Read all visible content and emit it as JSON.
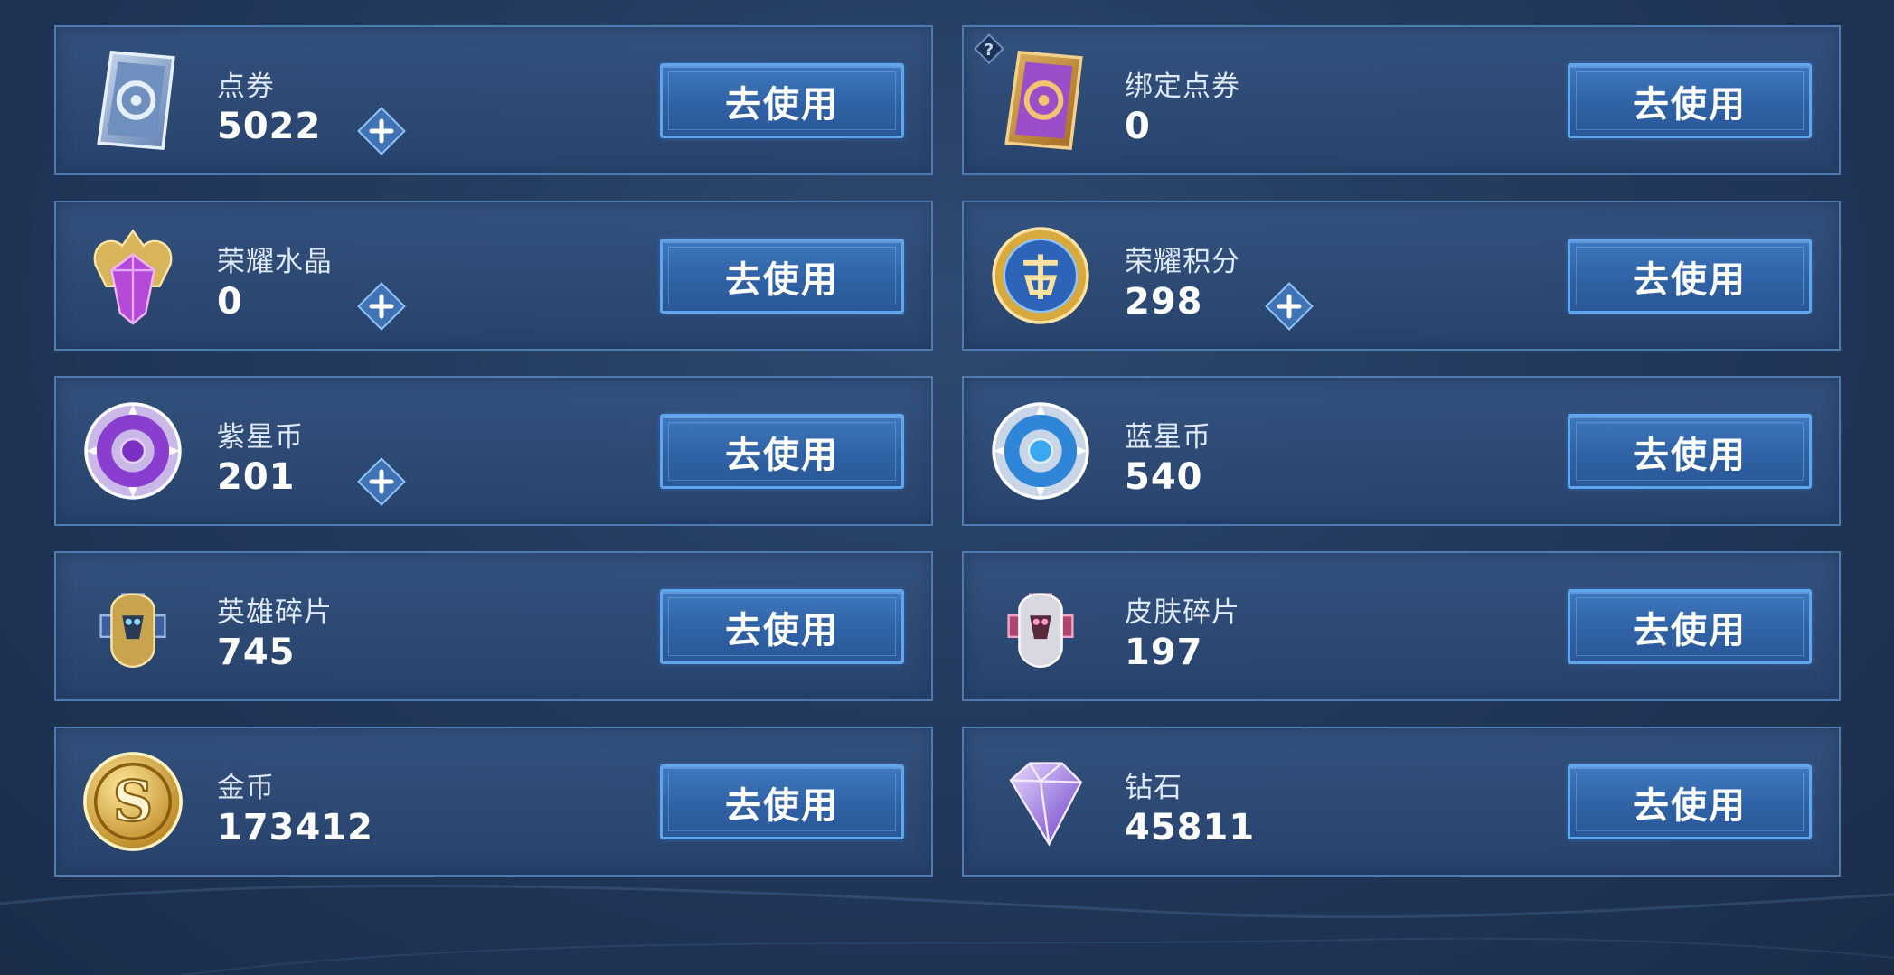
{
  "items": [
    {
      "label": "点券",
      "value": "5022",
      "icon": "coupon-blue-icon",
      "has_plus": true,
      "has_help": false
    },
    {
      "label": "绑定点券",
      "value": "0",
      "icon": "bound-coupon-purple-icon",
      "has_plus": false,
      "has_help": true
    },
    {
      "label": "荣耀水晶",
      "value": "0",
      "icon": "honor-crystal-icon",
      "has_plus": true,
      "has_help": false
    },
    {
      "label": "荣耀积分",
      "value": "298",
      "icon": "honor-points-icon",
      "has_plus": true,
      "has_help": false
    },
    {
      "label": "紫星币",
      "value": "201",
      "icon": "purple-star-coin-icon",
      "has_plus": true,
      "has_help": false
    },
    {
      "label": "蓝星币",
      "value": "540",
      "icon": "blue-star-coin-icon",
      "has_plus": false,
      "has_help": false
    },
    {
      "label": "英雄碎片",
      "value": "745",
      "icon": "hero-fragment-icon",
      "has_plus": false,
      "has_help": false
    },
    {
      "label": "皮肤碎片",
      "value": "197",
      "icon": "skin-fragment-icon",
      "has_plus": false,
      "has_help": false
    },
    {
      "label": "金币",
      "value": "173412",
      "icon": "gold-coin-icon",
      "has_plus": false,
      "has_help": false
    },
    {
      "label": "钻石",
      "value": "45811",
      "icon": "diamond-icon",
      "has_plus": false,
      "has_help": false
    }
  ],
  "use_button_label": "去使用",
  "help_symbol": "?",
  "colors": {
    "accent": "#5ea6ee",
    "card_border": "#4f7bb3",
    "background": "#233a5e"
  }
}
